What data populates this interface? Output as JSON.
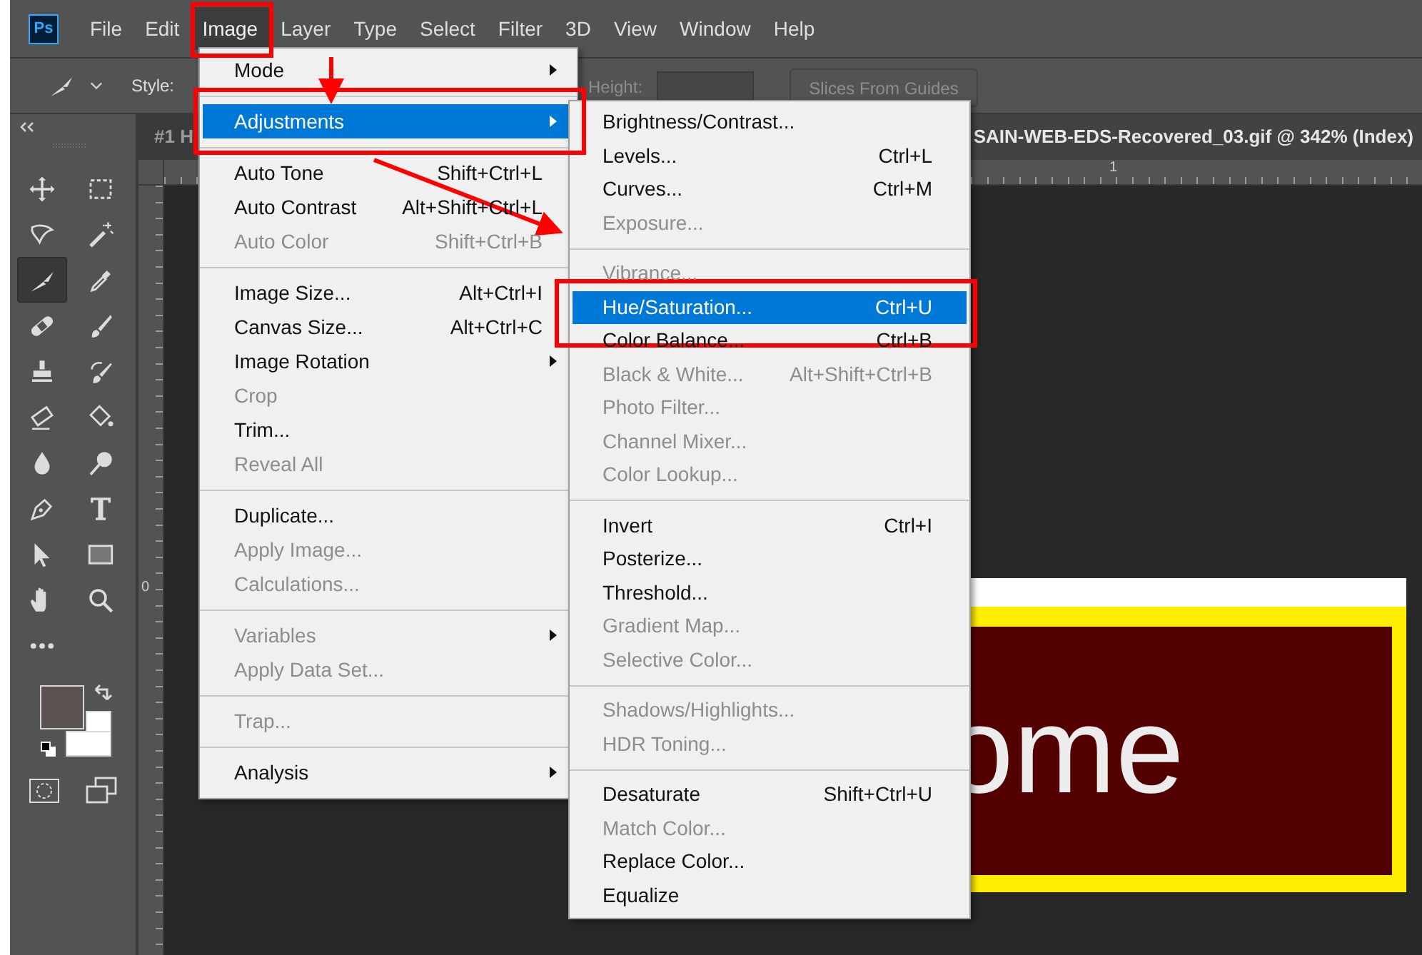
{
  "app_logo": "Ps",
  "menubar": [
    {
      "label": "File",
      "selected": false
    },
    {
      "label": "Edit",
      "selected": false
    },
    {
      "label": "Image",
      "selected": true
    },
    {
      "label": "Layer",
      "selected": false
    },
    {
      "label": "Type",
      "selected": false
    },
    {
      "label": "Select",
      "selected": false
    },
    {
      "label": "Filter",
      "selected": false
    },
    {
      "label": "3D",
      "selected": false
    },
    {
      "label": "View",
      "selected": false
    },
    {
      "label": "Window",
      "selected": false
    },
    {
      "label": "Help",
      "selected": false
    }
  ],
  "options_bar": {
    "style_label": "Style:",
    "height_label": "Height:",
    "slices_button": "Slices From Guides"
  },
  "document_tabs": [
    {
      "label": "#1 H",
      "selected": false
    },
    {
      "label": "SAIN-WEB-EDS-Recovered_03.gif @ 342% (Index)",
      "selected": true
    }
  ],
  "rulers": {
    "top_label": "1",
    "left_label": "0"
  },
  "tools": [
    {
      "kind": "move",
      "selected": false
    },
    {
      "kind": "marquee",
      "selected": false
    },
    {
      "kind": "lasso",
      "selected": false
    },
    {
      "kind": "wand",
      "selected": false
    },
    {
      "kind": "knife",
      "selected": true
    },
    {
      "kind": "eyedropper",
      "selected": false
    },
    {
      "kind": "bandage",
      "selected": false
    },
    {
      "kind": "brush",
      "selected": false
    },
    {
      "kind": "stamp",
      "selected": false
    },
    {
      "kind": "historybrush",
      "selected": false
    },
    {
      "kind": "eraser",
      "selected": false
    },
    {
      "kind": "bucket",
      "selected": false
    },
    {
      "kind": "drop",
      "selected": false
    },
    {
      "kind": "dodge",
      "selected": false
    },
    {
      "kind": "pen",
      "selected": false
    },
    {
      "kind": "type",
      "selected": false
    },
    {
      "kind": "pointer",
      "selected": false
    },
    {
      "kind": "rectangle",
      "selected": false
    },
    {
      "kind": "hand",
      "selected": false
    },
    {
      "kind": "zoom",
      "selected": false
    },
    {
      "kind": "more",
      "selected": false
    }
  ],
  "canvas_text": "ome",
  "image_menu": [
    {
      "kind": "item",
      "label": "Mode",
      "disabled": false,
      "selected": false,
      "submenu": true
    },
    {
      "kind": "separator"
    },
    {
      "kind": "item",
      "label": "Adjustments",
      "disabled": false,
      "selected": true,
      "submenu": true
    },
    {
      "kind": "separator"
    },
    {
      "kind": "item",
      "label": "Auto Tone",
      "shortcut": "Shift+Ctrl+L",
      "disabled": false,
      "selected": false,
      "submenu": false
    },
    {
      "kind": "item",
      "label": "Auto Contrast",
      "shortcut": "Alt+Shift+Ctrl+L",
      "disabled": false,
      "selected": false,
      "submenu": false
    },
    {
      "kind": "item",
      "label": "Auto Color",
      "shortcut": "Shift+Ctrl+B",
      "disabled": true,
      "selected": false,
      "submenu": false
    },
    {
      "kind": "separator"
    },
    {
      "kind": "item",
      "label": "Image Size...",
      "shortcut": "Alt+Ctrl+I",
      "disabled": false,
      "selected": false,
      "submenu": false
    },
    {
      "kind": "item",
      "label": "Canvas Size...",
      "shortcut": "Alt+Ctrl+C",
      "disabled": false,
      "selected": false,
      "submenu": false
    },
    {
      "kind": "item",
      "label": "Image Rotation",
      "disabled": false,
      "selected": false,
      "submenu": true
    },
    {
      "kind": "item",
      "label": "Crop",
      "disabled": true,
      "selected": false,
      "submenu": false
    },
    {
      "kind": "item",
      "label": "Trim...",
      "disabled": false,
      "selected": false,
      "submenu": false
    },
    {
      "kind": "item",
      "label": "Reveal All",
      "disabled": true,
      "selected": false,
      "submenu": false
    },
    {
      "kind": "separator"
    },
    {
      "kind": "item",
      "label": "Duplicate...",
      "disabled": false,
      "selected": false,
      "submenu": false
    },
    {
      "kind": "item",
      "label": "Apply Image...",
      "disabled": true,
      "selected": false,
      "submenu": false
    },
    {
      "kind": "item",
      "label": "Calculations...",
      "disabled": true,
      "selected": false,
      "submenu": false
    },
    {
      "kind": "separator"
    },
    {
      "kind": "item",
      "label": "Variables",
      "disabled": true,
      "selected": false,
      "submenu": true
    },
    {
      "kind": "item",
      "label": "Apply Data Set...",
      "disabled": true,
      "selected": false,
      "submenu": false
    },
    {
      "kind": "separator"
    },
    {
      "kind": "item",
      "label": "Trap...",
      "disabled": true,
      "selected": false,
      "submenu": false
    },
    {
      "kind": "separator"
    },
    {
      "kind": "item",
      "label": "Analysis",
      "disabled": false,
      "selected": false,
      "submenu": true
    }
  ],
  "adjustments_menu": [
    {
      "kind": "item",
      "label": "Brightness/Contrast...",
      "disabled": false,
      "selected": false
    },
    {
      "kind": "item",
      "label": "Levels...",
      "shortcut": "Ctrl+L",
      "disabled": false,
      "selected": false
    },
    {
      "kind": "item",
      "label": "Curves...",
      "shortcut": "Ctrl+M",
      "disabled": false,
      "selected": false
    },
    {
      "kind": "item",
      "label": "Exposure...",
      "disabled": true,
      "selected": false
    },
    {
      "kind": "separator"
    },
    {
      "kind": "item",
      "label": "Vibrance...",
      "disabled": true,
      "selected": false
    },
    {
      "kind": "item",
      "label": "Hue/Saturation...",
      "shortcut": "Ctrl+U",
      "disabled": false,
      "selected": true
    },
    {
      "kind": "item",
      "label": "Color Balance...",
      "shortcut": "Ctrl+B",
      "disabled": false,
      "selected": false
    },
    {
      "kind": "item",
      "label": "Black & White...",
      "shortcut": "Alt+Shift+Ctrl+B",
      "disabled": true,
      "selected": false
    },
    {
      "kind": "item",
      "label": "Photo Filter...",
      "disabled": true,
      "selected": false
    },
    {
      "kind": "item",
      "label": "Channel Mixer...",
      "disabled": true,
      "selected": false
    },
    {
      "kind": "item",
      "label": "Color Lookup...",
      "disabled": true,
      "selected": false
    },
    {
      "kind": "separator"
    },
    {
      "kind": "item",
      "label": "Invert",
      "shortcut": "Ctrl+I",
      "disabled": false,
      "selected": false
    },
    {
      "kind": "item",
      "label": "Posterize...",
      "disabled": false,
      "selected": false
    },
    {
      "kind": "item",
      "label": "Threshold...",
      "disabled": false,
      "selected": false
    },
    {
      "kind": "item",
      "label": "Gradient Map...",
      "disabled": true,
      "selected": false
    },
    {
      "kind": "item",
      "label": "Selective Color...",
      "disabled": true,
      "selected": false
    },
    {
      "kind": "separator"
    },
    {
      "kind": "item",
      "label": "Shadows/Highlights...",
      "disabled": true,
      "selected": false
    },
    {
      "kind": "item",
      "label": "HDR Toning...",
      "disabled": true,
      "selected": false
    },
    {
      "kind": "separator"
    },
    {
      "kind": "item",
      "label": "Desaturate",
      "shortcut": "Shift+Ctrl+U",
      "disabled": false,
      "selected": false
    },
    {
      "kind": "item",
      "label": "Match Color...",
      "disabled": true,
      "selected": false
    },
    {
      "kind": "item",
      "label": "Replace Color...",
      "disabled": false,
      "selected": false
    },
    {
      "kind": "item",
      "label": "Equalize",
      "disabled": false,
      "selected": false
    }
  ]
}
